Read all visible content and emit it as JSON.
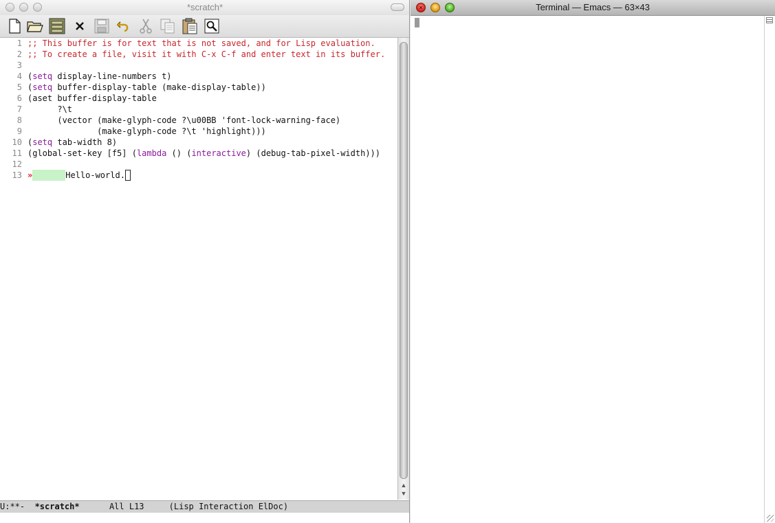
{
  "emacs": {
    "title": "*scratch*",
    "toolbar": [
      {
        "name": "new-file-button",
        "icon": "new-file-icon"
      },
      {
        "name": "open-folder-button",
        "icon": "open-folder-icon"
      },
      {
        "name": "dired-button",
        "icon": "file-cabinet-icon"
      },
      {
        "name": "close-buffer-button",
        "icon": "close-icon"
      },
      {
        "name": "save-button",
        "icon": "save-icon"
      },
      {
        "name": "undo-button",
        "icon": "undo-icon"
      },
      {
        "name": "cut-button",
        "icon": "scissors-icon"
      },
      {
        "name": "copy-button",
        "icon": "copy-icon"
      },
      {
        "name": "paste-button",
        "icon": "paste-icon"
      },
      {
        "name": "search-button",
        "icon": "search-icon"
      }
    ],
    "lines": {
      "l1": {
        "num": "1",
        "text": ";; This buffer is for text that is not saved, and for Lisp evaluation."
      },
      "l2": {
        "num": "2",
        "text": ";; To create a file, visit it with C-x C-f and enter text in its buffer."
      },
      "l3": {
        "num": "3"
      },
      "l4": {
        "num": "4",
        "a": "(",
        "kw": "setq",
        "b": " display-line-numbers t)"
      },
      "l5": {
        "num": "5",
        "a": "(",
        "kw": "setq",
        "b": " buffer-display-table (make-display-table))"
      },
      "l6": {
        "num": "6",
        "text": "(aset buffer-display-table"
      },
      "l7": {
        "num": "7",
        "text": "      ?\\t"
      },
      "l8": {
        "num": "8",
        "text": "      (vector (make-glyph-code ?\\u00BB 'font-lock-warning-face)"
      },
      "l9": {
        "num": "9",
        "text": "              (make-glyph-code ?\\t 'highlight)))"
      },
      "l10": {
        "num": "10",
        "a": "(",
        "kw": "setq",
        "b": " tab-width 8)"
      },
      "l11": {
        "num": "11",
        "a": "(global-set-key [f5] (",
        "kw": "lambda",
        "b": " () (",
        "kw2": "interactive",
        "c": ") (debug-tab-pixel-width)))"
      },
      "l12": {
        "num": "12"
      },
      "l13": {
        "num": "13",
        "glyph": "»",
        "text": "Hello-world."
      }
    },
    "modeline": {
      "status": "U:**-  ",
      "buffer": "*scratch*",
      "position": "      All L13     ",
      "mode": "(Lisp Interaction ElDoc)"
    }
  },
  "terminal": {
    "title": "Terminal — Emacs — 63×43"
  },
  "colors": {
    "comment": "#c8262b",
    "keyword": "#8b1a9b",
    "warning_glyph": "#e0121a",
    "highlight": "#c8f2c8"
  }
}
